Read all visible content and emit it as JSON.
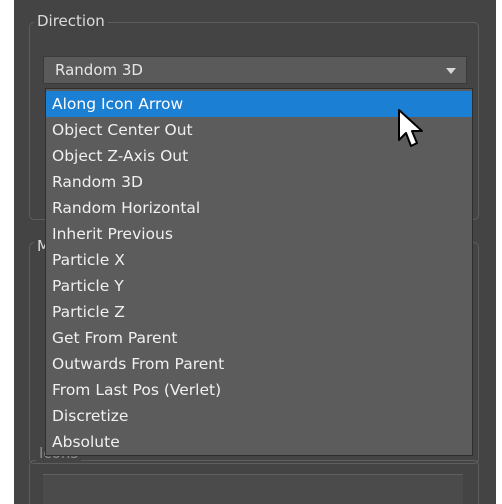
{
  "direction_group": {
    "legend": "Direction",
    "combo": {
      "selected": "Random 3D"
    },
    "options": [
      "Along Icon Arrow",
      "Object Center Out",
      "Object Z-Axis Out",
      "Random 3D",
      "Random Horizontal",
      "Inherit Previous",
      "Particle X",
      "Particle Y",
      "Particle Z",
      "Get From Parent",
      "Outwards From Parent",
      "From Last Pos (Verlet)",
      "Discretize",
      "Absolute"
    ],
    "highlighted_option": "Along Icon Arrow"
  },
  "second_group": {
    "legend_visible": "M"
  },
  "icons_group": {
    "legend": "Icons"
  },
  "colors": {
    "panel_bg": "#444444",
    "highlight": "#1b7fd4",
    "text": "#f0f0f0",
    "disabled_text": "#8c8c8c"
  },
  "cursor": {
    "icon": "arrow-pointer-icon"
  }
}
